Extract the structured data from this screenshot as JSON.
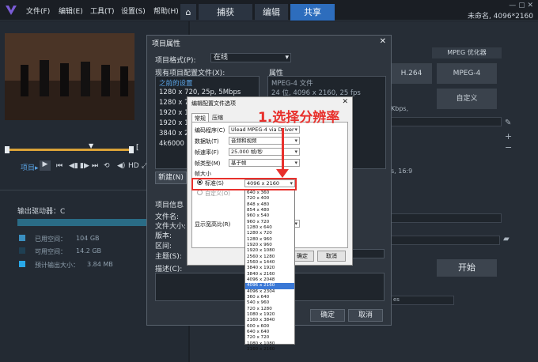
{
  "menu": {
    "items": [
      "文件(F)",
      "编辑(E)",
      "工具(T)",
      "设置(S)",
      "帮助(H)"
    ]
  },
  "tabs": {
    "capture": "捕获",
    "edit": "编辑",
    "share": "共享"
  },
  "project_title": "未命名, 4096*2160",
  "player": {
    "project_label": "项目▸"
  },
  "output": {
    "drive_label": "输出驱动器：C",
    "used_label": "已用空间：",
    "used_value": "104 GB",
    "free_label": "可用空间：",
    "free_value": "14.2 GB",
    "est_label": "预计输出大小：",
    "est_value": "3.84 MB"
  },
  "format_buttons": [
    "MPEG 优化器",
    "H.264",
    "MPEG-4",
    "自定义"
  ],
  "right_texts": {
    "kbps": "Kbps,",
    "ratio": "s, 16:9",
    "start": "开始"
  },
  "dialog1": {
    "title": "项目属性",
    "format_label": "项目格式(P):",
    "format_value": "在线",
    "profiles_label": "现有项目配置文件(X):",
    "properties_label": "属性",
    "profiles": [
      "之前的设置",
      "1280 x 720, 25p, 5Mbps",
      "1280 x 7",
      "1920 x 10",
      "1920 x 10",
      "3840 x 21",
      "4k6000"
    ],
    "properties": [
      "MPEG-4 文件",
      "24 位, 4096 x 2160, 25 fps"
    ],
    "new_button": "新建(N)",
    "info_label": "项目信息",
    "info_fields": [
      "文件名:",
      "文件大小:",
      "版本:",
      "区间:",
      "主题(S):",
      "描述(C):"
    ],
    "ok": "确定",
    "cancel": "取消"
  },
  "dialog2": {
    "title": "编辑配置文件选项",
    "tabs": [
      "常规",
      "压缩"
    ],
    "encoder_label": "编码程序(C)",
    "encoder_value": "Ulead MPEG-4 via Driver",
    "data_track_label": "数据轨(T)",
    "data_track_value": "音频和视频",
    "frame_rate_label": "帧速率(F)",
    "frame_rate_value": "25.000 帧/秒",
    "frame_type_label": "帧类型(M)",
    "frame_type_value": "基于帧",
    "frame_size_label": "帧大小",
    "standard_label": "标准(S)",
    "standard_value": "4096 x 2160",
    "custom_label": "自定义(O)",
    "aspect_label": "显示宽高比(R)",
    "ok": "确定",
    "cancel": "取消"
  },
  "dropdown": {
    "options": [
      "640 x 360",
      "720 x 400",
      "848 x 480",
      "854 x 480",
      "960 x 540",
      "960 x 720",
      "1280 x 640",
      "1280 x 720",
      "1280 x 960",
      "1920 x 960",
      "1920 x 1080",
      "2560 x 1280",
      "2560 x 1440",
      "3840 x 1920",
      "3840 x 2160",
      "4096 x 2048",
      "4096 x 2160",
      "4096 x 2304",
      "360 x 640",
      "540 x 960",
      "720 x 1280",
      "1080 x 1920",
      "2160 x 3840",
      "600 x 600",
      "640 x 640",
      "720 x 720",
      "1080 x 1080",
      "2160 x 2160"
    ],
    "selected": "4096 x 2160"
  },
  "annotation": {
    "text": "1.选择分辨率"
  },
  "colors": {
    "accent": "#2d6dbd",
    "highlight": "#e8302c"
  }
}
